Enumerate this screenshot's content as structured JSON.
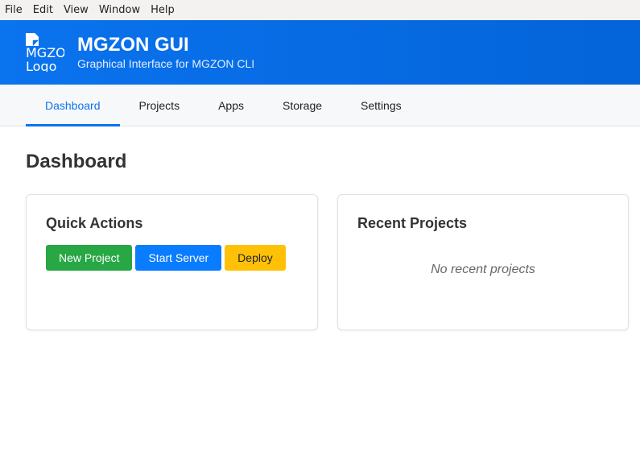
{
  "menubar": {
    "items": [
      "File",
      "Edit",
      "View",
      "Window",
      "Help"
    ]
  },
  "header": {
    "logo_alt": "MGZON Logo",
    "title": "MGZON GUI",
    "subtitle": "Graphical Interface for MGZON CLI",
    "gradient_start": "#0a73ee",
    "gradient_end": "#0464d9"
  },
  "tabs": [
    {
      "label": "Dashboard",
      "active": true
    },
    {
      "label": "Projects",
      "active": false
    },
    {
      "label": "Apps",
      "active": false
    },
    {
      "label": "Storage",
      "active": false
    },
    {
      "label": "Settings",
      "active": false
    }
  ],
  "main": {
    "title": "Dashboard",
    "quick_actions": {
      "title": "Quick Actions",
      "buttons": [
        {
          "label": "New Project",
          "color": "#28a745"
        },
        {
          "label": "Start Server",
          "color": "#0a7cff"
        },
        {
          "label": "Deploy",
          "color": "#ffc107"
        }
      ]
    },
    "recent_projects": {
      "title": "Recent Projects",
      "empty_text": "No recent projects"
    }
  }
}
